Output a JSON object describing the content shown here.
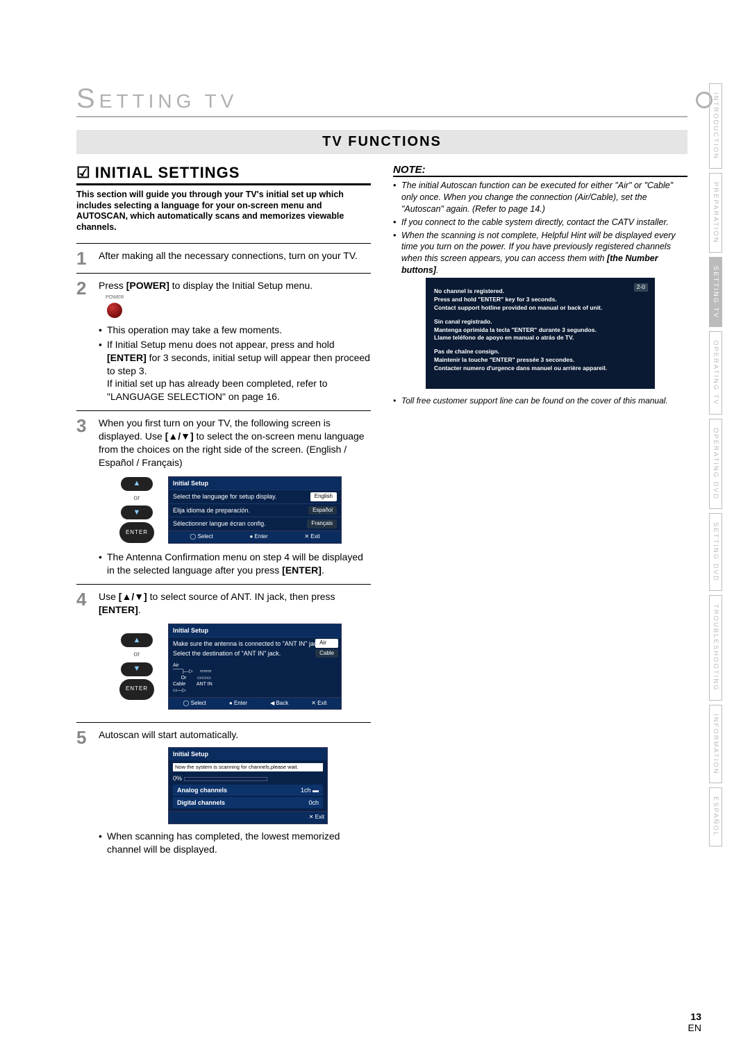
{
  "chapter_title_prefix": "S",
  "chapter_title_rest": "ETTING  TV",
  "functions_title": "TV FUNCTIONS",
  "section_title": "INITIAL SETTINGS",
  "intro": "This section will guide you through your TV's initial set up which includes selecting a language for your on-screen menu and AUTOSCAN, which automatically scans and memorizes viewable channels.",
  "steps": {
    "s1_num": "1",
    "s1": "After making all the necessary connections, turn on your TV.",
    "s2_num": "2",
    "s2_a": "Press ",
    "s2_b": "[POWER]",
    "s2_c": " to display the Initial Setup menu.",
    "s2_power_label": "POWER",
    "s2_bul1": "This operation may take a few moments.",
    "s2_bul2_a": "If Initial Setup menu does not appear, press and hold ",
    "s2_bul2_b": "[ENTER]",
    "s2_bul2_c": " for 3 seconds, initial setup will appear then proceed to step 3.",
    "s2_bul2_d": "If initial set up has already been completed, refer to \"LANGUAGE SELECTION\" on page 16.",
    "s3_num": "3",
    "s3_a": "When you first turn on your TV, the following screen is displayed. Use ",
    "s3_b": "[▲/▼]",
    "s3_c": " to select the on-screen menu language from the choices on the right side of the screen. (English / Español / Français)",
    "s3_bul1_a": "The Antenna Confirmation menu on step 4 will be displayed in the selected language after you press ",
    "s3_bul1_b": "[ENTER]",
    "s3_bul1_c": ".",
    "s4_num": "4",
    "s4_a": "Use ",
    "s4_b": "[▲/▼]",
    "s4_c": " to select source of ANT. IN jack, then press ",
    "s4_d": "[ENTER]",
    "s4_e": ".",
    "s5_num": "5",
    "s5": "Autoscan will start automatically.",
    "s5_bul1": "When scanning has completed, the lowest memorized channel will be displayed."
  },
  "remote": {
    "or": "or",
    "enter": "ENTER"
  },
  "osd_lang": {
    "hdr": "Initial Setup",
    "r1": "Select the language for setup display.",
    "o1": "English",
    "r2": "Elija idioma de preparación.",
    "o2": "Español",
    "r3": "Sélectionner langue écran config.",
    "o3": "Français",
    "f_select": "Select",
    "f_enter": "Enter",
    "f_exit": "Exit"
  },
  "osd_ant": {
    "hdr": "Initial Setup",
    "l1": "Make sure the antenna is connected to \"ANT IN\" jack.",
    "l2": "Select the destination of \"ANT IN\" jack.",
    "o1": "Air",
    "o2": "Cable",
    "diag_air": "Air",
    "diag_or": "Or",
    "diag_cable": "Cable",
    "diag_antin": "ANT IN",
    "f_select": "Select",
    "f_enter": "Enter",
    "f_back": "Back",
    "f_exit": "Exit"
  },
  "osd_scan": {
    "hdr": "Initial Setup",
    "msg": "Now the system is scanning for channels,please wait.",
    "pct": "0%",
    "r1": "Analog channels",
    "v1": "1ch",
    "r2": "Digital channels",
    "v2": "0ch",
    "f_exit": "Exit"
  },
  "note_hdr": "NOTE:",
  "notes": {
    "n1": "The initial Autoscan function can be executed for either \"Air\" or \"Cable\" only once. When you change the connection (Air/Cable), set the \"Autoscan\" again. (Refer to page 14.)",
    "n2": "If you connect to the cable system directly, contact the CATV installer.",
    "n3_a": "When the scanning is not complete, Helpful Hint will be displayed every time you turn on the power. If you have previously registered channels when this screen appears, you can access them with ",
    "n3_b": "[the Number buttons]",
    "n3_c": "."
  },
  "osd_hint": {
    "corner": "2-0",
    "b1_l1": "No channel is registered.",
    "b1_l2": "Press and hold \"ENTER\" key for 3 seconds.",
    "b1_l3": "Contact support hotline provided on manual or back of unit.",
    "b2_l1": "Sin canal registrado.",
    "b2_l2": "Mantenga oprimida la tecla \"ENTER\" durante 3 segundos.",
    "b2_l3": "Llame teléfono de apoyo en manual o atrás de TV.",
    "b3_l1": "Pas de chaîne consign.",
    "b3_l2": "Maintenir la touche \"ENTER\" pressée 3 secondes.",
    "b3_l3": "Contacter numero d'urgence dans manuel ou arrière appareil."
  },
  "toll": "Toll free customer support line can be found on the cover of this manual.",
  "tabs": {
    "t1": "INTRODUCTION",
    "t2": "PREPARATION",
    "t3": "SETTING TV",
    "t4": "OPERATING TV",
    "t5": "OPERATING DVD",
    "t6": "SETTING DVD",
    "t7": "TROUBLESHOOTING",
    "t8": "INFORMATION",
    "t9": "ESPAÑOL"
  },
  "page_number": "13",
  "page_lang": "EN"
}
